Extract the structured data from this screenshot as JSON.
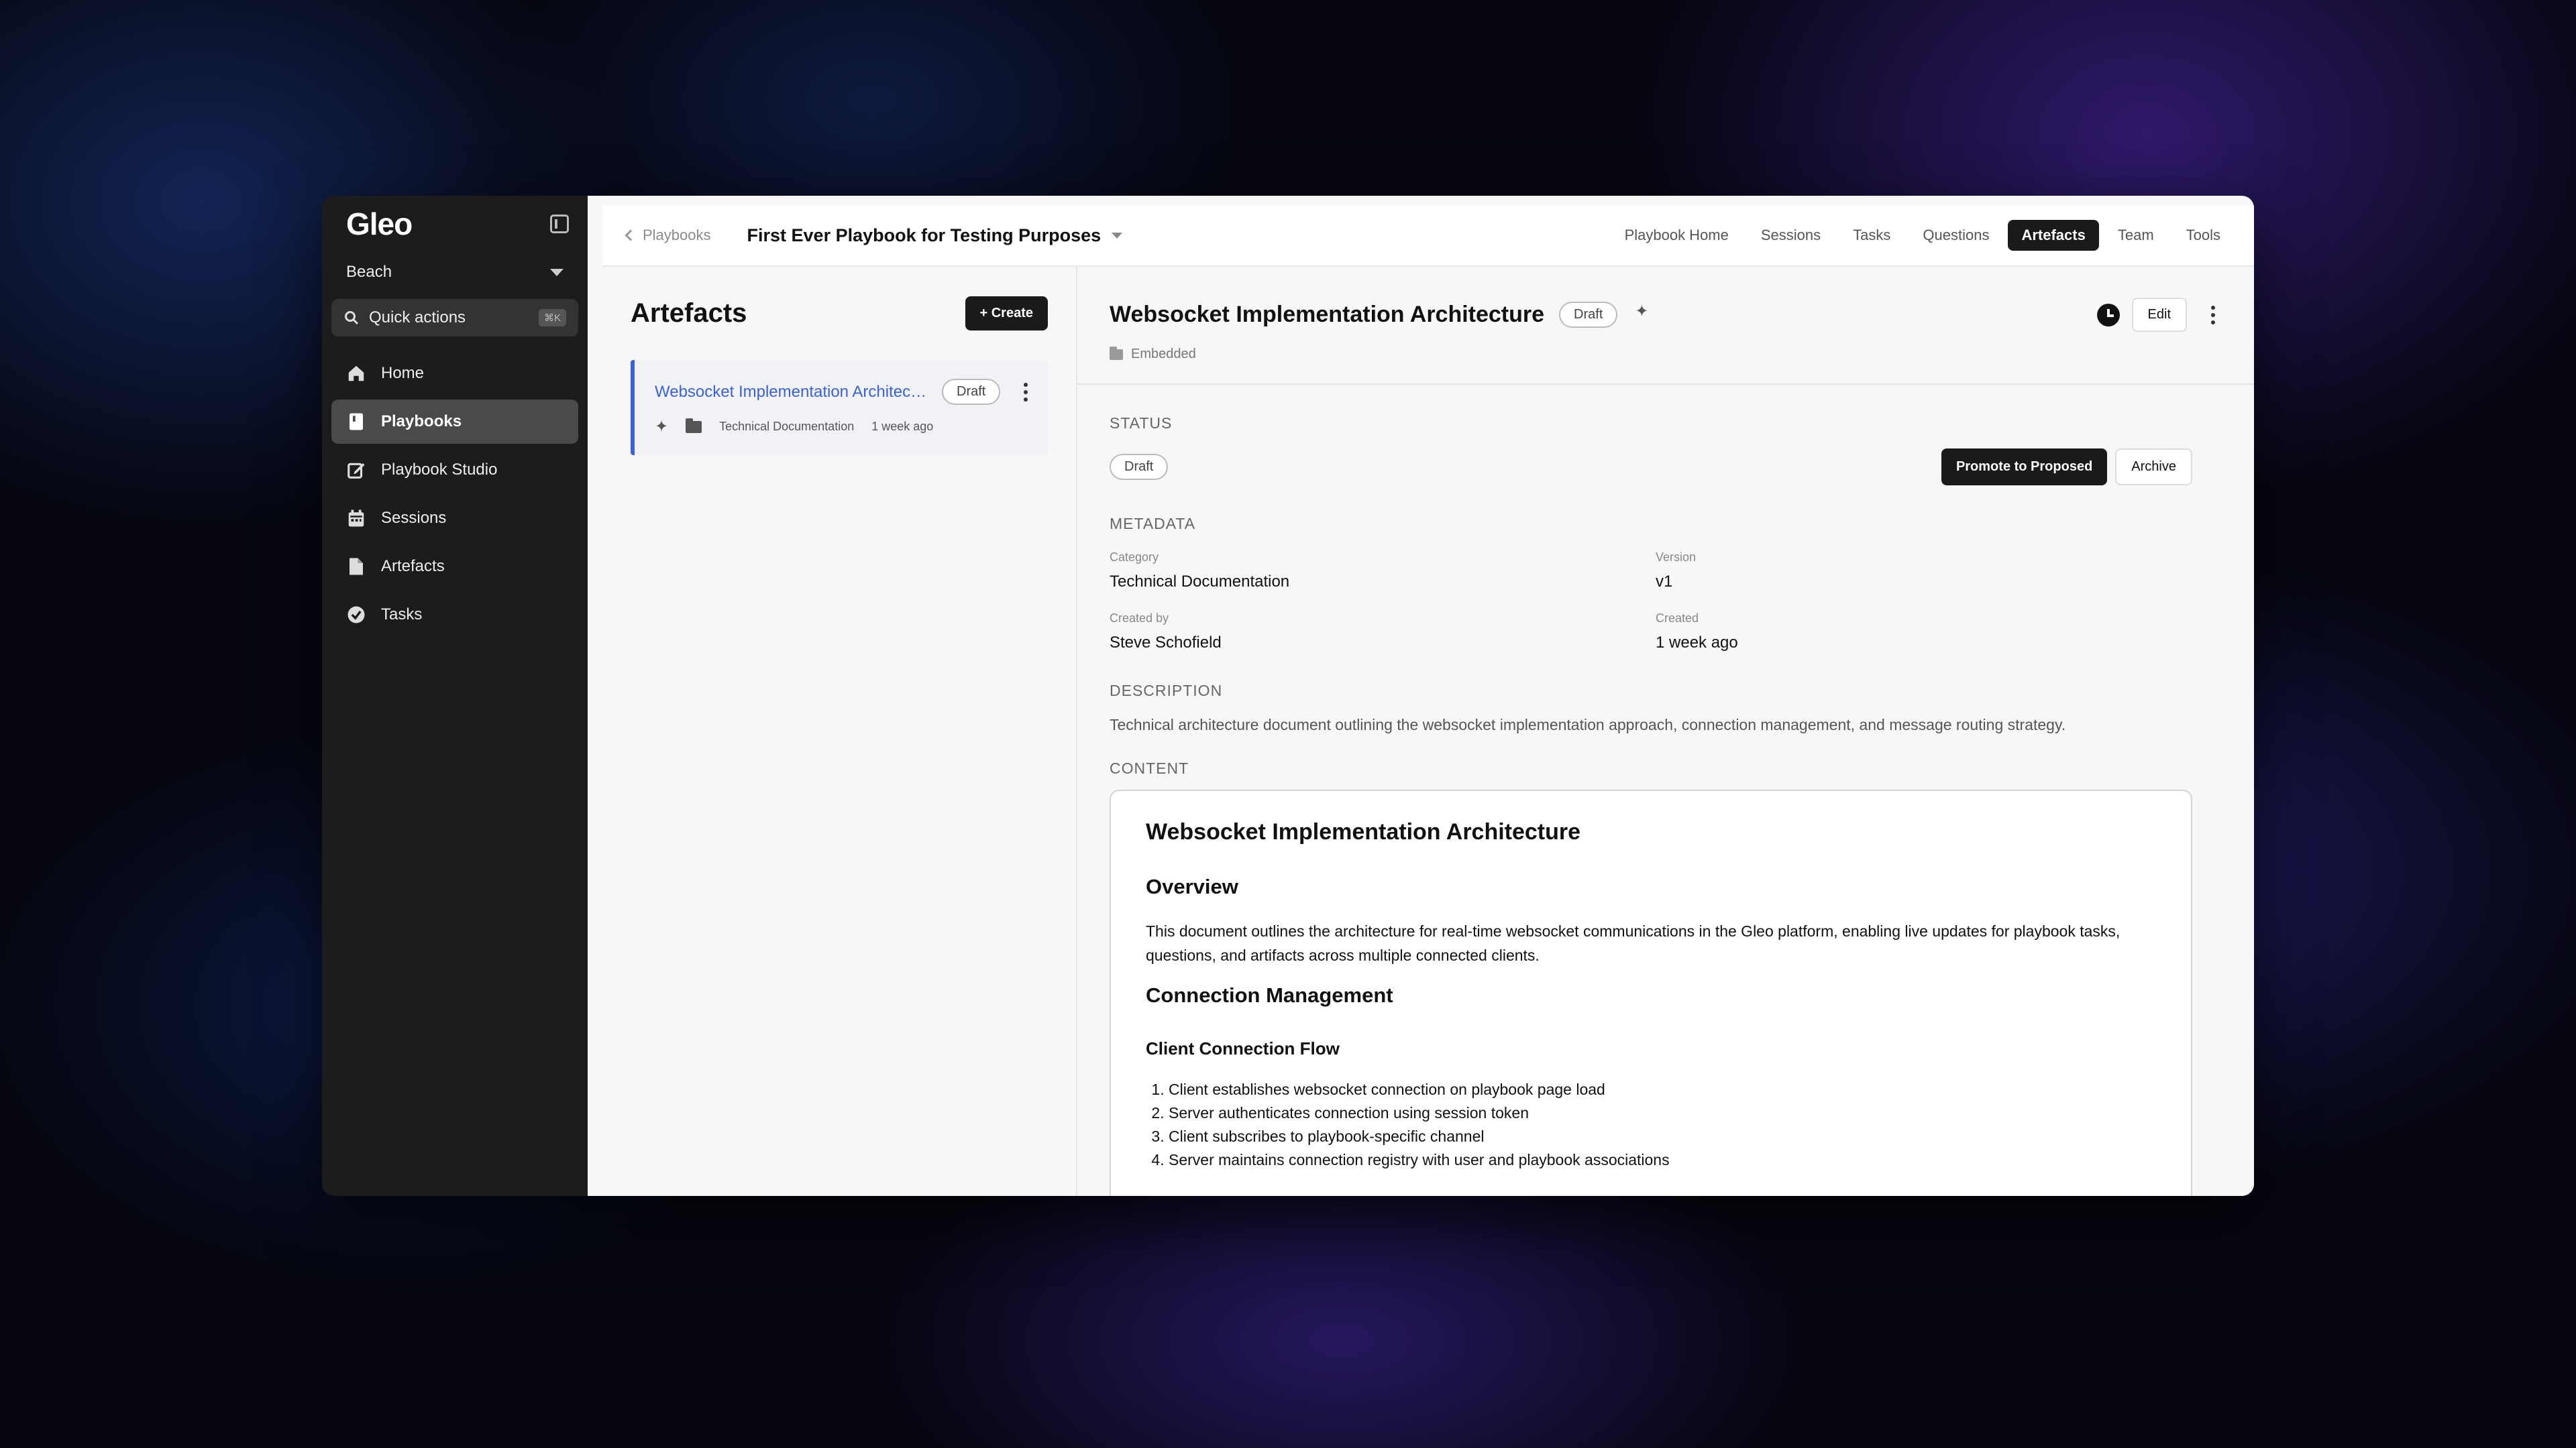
{
  "sidebar": {
    "logo": "Gleo",
    "workspace": "Beach",
    "quick_actions": {
      "label": "Quick actions",
      "shortcut": "⌘K"
    },
    "items": [
      {
        "label": "Home",
        "icon": "home-icon"
      },
      {
        "label": "Playbooks",
        "icon": "book-icon",
        "active": true
      },
      {
        "label": "Playbook Studio",
        "icon": "edit-icon"
      },
      {
        "label": "Sessions",
        "icon": "calendar-icon"
      },
      {
        "label": "Artefacts",
        "icon": "file-icon"
      },
      {
        "label": "Tasks",
        "icon": "check-circle-icon"
      }
    ]
  },
  "topbar": {
    "breadcrumb": "Playbooks",
    "playbook_title": "First Ever Playbook for Testing Purposes",
    "tabs": [
      "Playbook Home",
      "Sessions",
      "Tasks",
      "Questions",
      "Artefacts",
      "Team",
      "Tools"
    ],
    "active_tab": "Artefacts"
  },
  "list": {
    "title": "Artefacts",
    "create_label": "+ Create",
    "card": {
      "title": "Websocket Implementation Architecture",
      "badge": "Draft",
      "category": "Technical Documentation",
      "time": "1 week ago"
    }
  },
  "detail": {
    "title": "Websocket Implementation Architecture",
    "badge": "Draft",
    "edit_label": "Edit",
    "embedded": "Embedded",
    "status_label": "STATUS",
    "status_value": "Draft",
    "promote_label": "Promote to Proposed",
    "archive_label": "Archive",
    "metadata_label": "METADATA",
    "meta": {
      "category_k": "Category",
      "category_v": "Technical Documentation",
      "version_k": "Version",
      "version_v": "v1",
      "created_by_k": "Created by",
      "created_by_v": "Steve Schofield",
      "created_k": "Created",
      "created_v": "1 week ago"
    },
    "description_label": "DESCRIPTION",
    "description": "Technical architecture document outlining the websocket implementation approach, connection management, and message routing strategy.",
    "content_label": "CONTENT",
    "content": {
      "h1": "Websocket Implementation Architecture",
      "h2_overview": "Overview",
      "p_overview": "This document outlines the architecture for real-time websocket communications in the Gleo platform, enabling live updates for playbook tasks, questions, and artifacts across multiple connected clients.",
      "h2_conn": "Connection Management",
      "h3_flow": "Client Connection Flow",
      "steps": [
        "Client establishes websocket connection on playbook page load",
        "Server authenticates connection using session token",
        "Client subscribes to playbook-specific channel",
        "Server maintains connection registry with user and playbook associations"
      ]
    }
  }
}
